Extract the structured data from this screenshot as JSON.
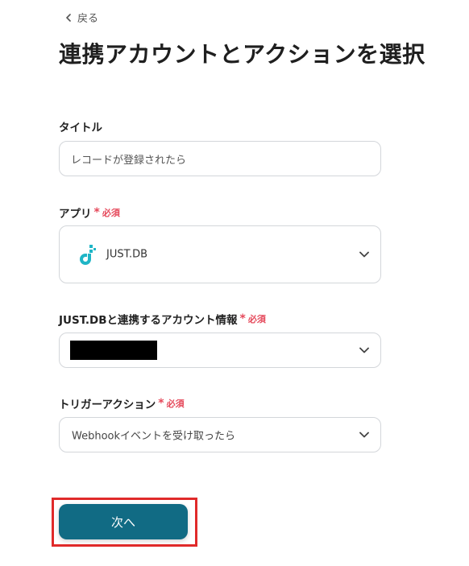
{
  "header": {
    "back_label": "戻る",
    "title": "連携アカウントとアクションを選択"
  },
  "form": {
    "title_field": {
      "label": "タイトル",
      "value": "レコードが登録されたら"
    },
    "app_field": {
      "label": "アプリ",
      "required_mark": "*",
      "required_text": "必須",
      "selected_app": "JUST.DB",
      "logo_color": "#1fb5c6"
    },
    "account_field": {
      "label": "JUST.DBと連携するアカウント情報",
      "required_mark": "*",
      "required_text": "必須"
    },
    "trigger_field": {
      "label": "トリガーアクション",
      "required_mark": "*",
      "required_text": "必須",
      "selected_action": "Webhookイベントを受け取ったら"
    }
  },
  "footer": {
    "next_label": "次へ",
    "button_color": "#116b84",
    "highlight_color": "#e02a2a"
  }
}
